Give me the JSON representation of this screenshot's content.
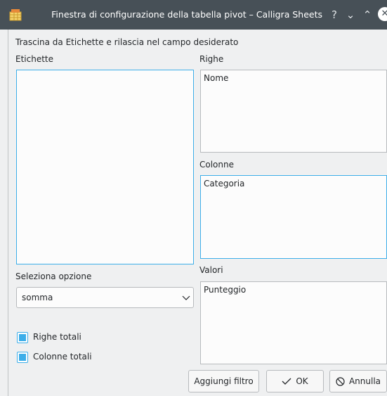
{
  "window": {
    "title": "Finestra di configurazione della tabella pivot – Calligra Sheets",
    "help_glyph": "?",
    "minimize_glyph": "⌄",
    "maximize_glyph": "⌃",
    "close_glyph": "✕"
  },
  "instruction": "Trascina da Etichette e rilascia nel campo desiderato",
  "labels_section": {
    "title": "Etichette",
    "items": []
  },
  "rows_section": {
    "title": "Righe",
    "items": [
      "Nome"
    ]
  },
  "columns_section": {
    "title": "Colonne",
    "items": [
      "Categoria"
    ]
  },
  "values_section": {
    "title": "Valori",
    "items": [
      "Punteggio"
    ]
  },
  "option": {
    "title": "Seleziona opzione",
    "selected": "somma"
  },
  "checkboxes": [
    {
      "label": "Righe totali",
      "checked": true
    },
    {
      "label": "Colonne totali",
      "checked": true
    }
  ],
  "buttons": {
    "add_filter": "Aggiungi filtro",
    "ok": "OK",
    "cancel": "Annulla"
  },
  "colors": {
    "accent": "#3daee9",
    "titlebar": "#475057"
  }
}
